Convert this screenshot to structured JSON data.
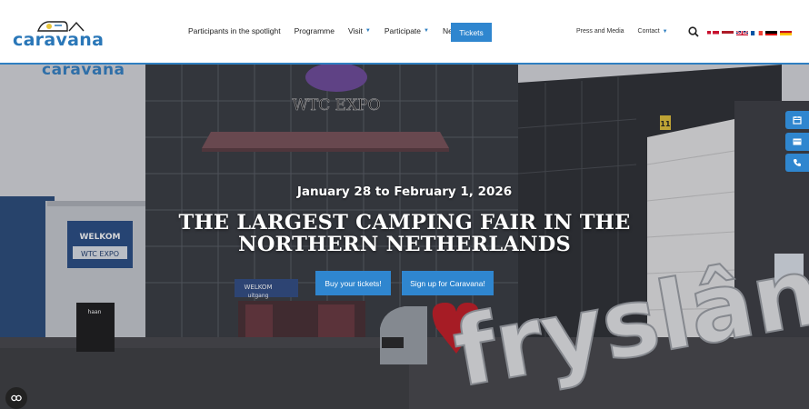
{
  "logo": {
    "text": "caravana",
    "ghost_text": "caravana"
  },
  "nav": {
    "items": [
      {
        "label": "Participants in the spotlight",
        "dropdown": false
      },
      {
        "label": "Programme",
        "dropdown": false
      },
      {
        "label": "Visit",
        "dropdown": true
      },
      {
        "label": "Participate",
        "dropdown": true
      },
      {
        "label": "News",
        "dropdown": false
      }
    ],
    "tickets_label": "Tickets",
    "right_items": [
      {
        "label": "Press and Media",
        "dropdown": false
      },
      {
        "label": "Contact",
        "dropdown": true
      }
    ],
    "search_icon": "search-icon",
    "flags": [
      "danish-flag",
      "dutch-flag",
      "uk-flag",
      "french-flag",
      "german-flag",
      "spanish-flag"
    ]
  },
  "hero": {
    "date": "January 28 to February 1, 2026",
    "headline_line1": "THE LARGEST CAMPING FAIR IN THE",
    "headline_line2": "NORTHERN NETHERLANDS",
    "buttons": [
      {
        "label": "Buy your tickets!"
      },
      {
        "label": "Sign up for Caravana!"
      }
    ],
    "side_buttons": [
      "calendar-icon",
      "ticket-icon",
      "phone-icon"
    ],
    "scene_text": {
      "building_sign": "WTC EXPO",
      "welcome_sign": "WELKOM",
      "welcome_sub": "WTC EXPO",
      "entrance_sign": "WELKOM",
      "entrance_sub": "uitgang",
      "letters_sign": "fryslân",
      "van_brand": "haan",
      "door_number": "11"
    }
  },
  "cookie_icon": "cookie-settings-icon",
  "colors": {
    "accent": "#2f86cf",
    "logo": "#2a77b8"
  }
}
